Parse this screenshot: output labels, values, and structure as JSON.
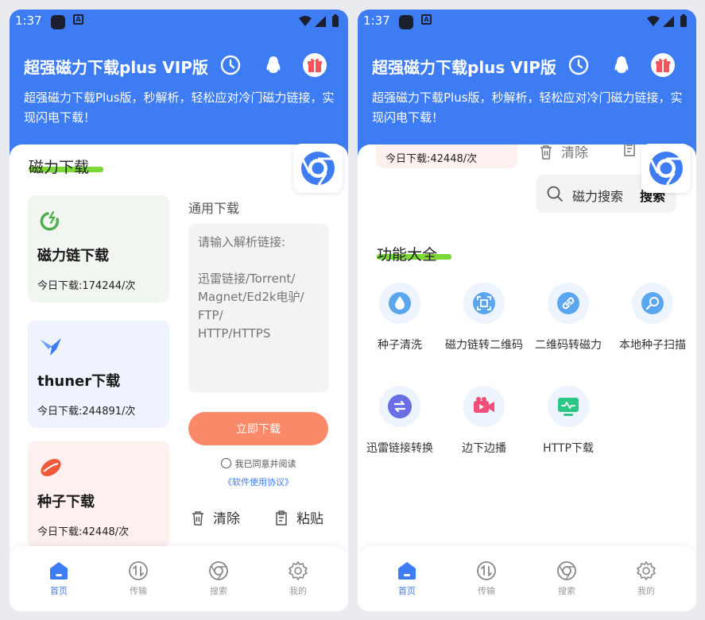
{
  "status": {
    "time": "1:37"
  },
  "header": {
    "title": "超强磁力下载plus VIP版",
    "subtitle": "超强磁力下载Plus版，秒解析，轻松应对冷门磁力链接，实现闪电下载！"
  },
  "left": {
    "section_title": "磁力下载",
    "download_cards": [
      {
        "name": "磁力链下载",
        "count": "今日下载:174244/次",
        "icon": "magnet-icon",
        "color": "#f2f6f0",
        "accent": "#4caf50"
      },
      {
        "name": "thuner下载",
        "count": "今日下载:244891/次",
        "icon": "bird-icon",
        "color": "#eef3fd",
        "accent": "#3d7cf2"
      },
      {
        "name": "种子下载",
        "count": "今日下载:42448/次",
        "icon": "seed-icon",
        "color": "#fdf0ee",
        "accent": "#ef5a3a"
      }
    ],
    "general": {
      "label": "通用下载",
      "placeholder": "请输入解析链接:\n\n迅雷链接/Torrent/\nMagnet/Ed2k电驴/\nFTP/\nHTTP/HTTPS",
      "download_button": "立即下载",
      "agree_text": "我已同意并阅读",
      "terms_link": "《软件使用协议》",
      "clear_label": "清除",
      "paste_label": "粘贴"
    }
  },
  "right": {
    "fragment_count": "今日下载:42448/次",
    "clear_label": "清除",
    "paste_label": "粘贴",
    "search": {
      "placeholder": "磁力搜索",
      "button": "搜索"
    },
    "section_title": "功能大全",
    "features": [
      {
        "label": "种子清洗",
        "icon": "drop-icon",
        "color": "#5aa6ef"
      },
      {
        "label": "磁力链转二维码",
        "icon": "qr-scan-icon",
        "color": "#5aa6ef"
      },
      {
        "label": "二维码转磁力",
        "icon": "link-icon",
        "color": "#5aa6ef"
      },
      {
        "label": "本地种子扫描",
        "icon": "search-scan-icon",
        "color": "#5aa6ef"
      },
      {
        "label": "迅雷链接转换",
        "icon": "swap-icon",
        "color": "#6b6fe6"
      },
      {
        "label": "边下边播",
        "icon": "video-icon",
        "color": "#ef4f78"
      },
      {
        "label": "HTTP下载",
        "icon": "monitor-icon",
        "color": "#2cc784"
      }
    ]
  },
  "nav": {
    "items": [
      {
        "label": "首页",
        "icon": "home-icon"
      },
      {
        "label": "传输",
        "icon": "transfer-icon"
      },
      {
        "label": "搜索",
        "icon": "chrome-search-icon"
      },
      {
        "label": "我的",
        "icon": "gear-icon"
      }
    ]
  },
  "colors": {
    "primary": "#3d7cf2",
    "download_button": "#f98a69",
    "highlight": "#7bd936"
  }
}
